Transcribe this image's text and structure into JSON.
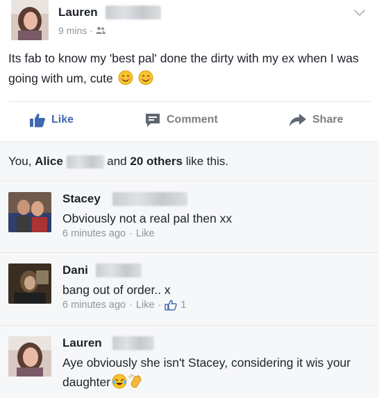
{
  "post": {
    "author": "Lauren",
    "timestamp": "9 mins",
    "audience_icon": "friends-icon",
    "text": "Its fab to know my 'best pal' done the dirty with my ex when I was going with um, cute",
    "emojis": [
      "blush-emoji",
      "blush-emoji"
    ]
  },
  "actions": {
    "like_label": "Like",
    "comment_label": "Comment",
    "share_label": "Share"
  },
  "likes_summary": {
    "prefix": "You,",
    "name": "Alice",
    "middle": "and",
    "others": "20 others",
    "suffix": "like this."
  },
  "comments": [
    {
      "author": "Stacey",
      "text": "Obviously not a real pal then xx",
      "time": "6 minutes ago",
      "like_label": "Like"
    },
    {
      "author": "Dani",
      "text": "bang out of order.. x",
      "time": "6 minutes ago",
      "like_label": "Like",
      "like_count": "1"
    },
    {
      "author": "Lauren",
      "text": "Aye obviously she isn't Stacey, considering it wis your daughter",
      "emojis": [
        "tears-of-joy-emoji",
        "clapping-hands-emoji"
      ]
    }
  ],
  "colors": {
    "link_blue": "#4267b2",
    "muted_gray": "#90949c",
    "text": "#1d2129",
    "comment_bg": "#f6f7f9"
  }
}
